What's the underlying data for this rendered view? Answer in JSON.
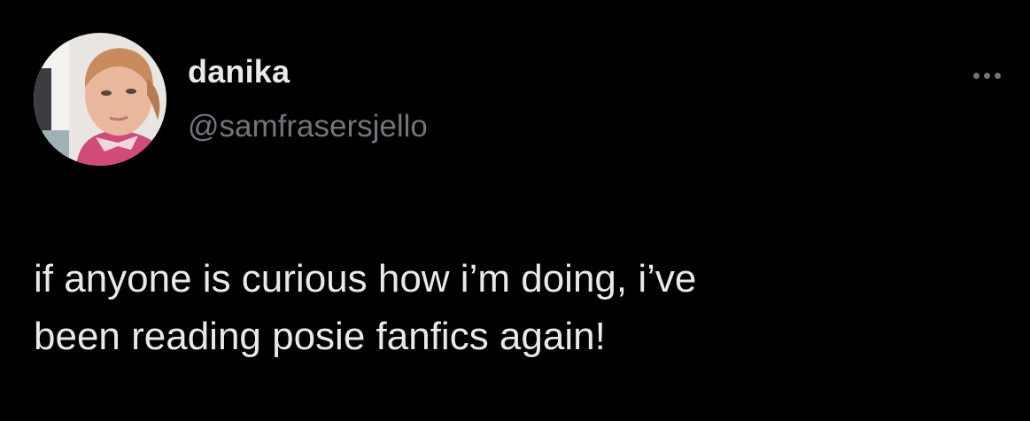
{
  "author": {
    "display_name": "danika",
    "handle": "@samfrasersjello",
    "avatar_icon": "profile-photo"
  },
  "actions": {
    "more_icon": "more-horizontal-icon"
  },
  "tweet": {
    "lines": [
      "if anyone is curious how i’m doing, i’ve",
      "been reading posie fanfics again!"
    ]
  },
  "colors": {
    "background": "#000000",
    "primary_text": "#e7e9ea",
    "secondary_text": "#71767b"
  }
}
